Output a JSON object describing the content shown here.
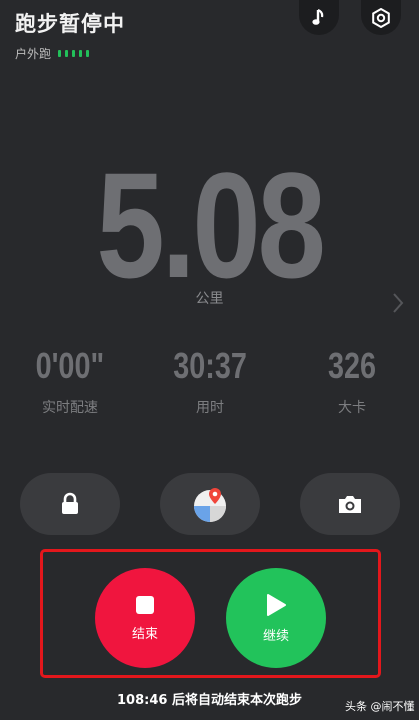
{
  "header": {
    "title": "跑步暂停中",
    "mode_label": "户外跑",
    "signal_bars": 5
  },
  "colors": {
    "background": "#28292c",
    "end_button": "#f0153e",
    "resume_button": "#22c35b",
    "signal": "#22c05a",
    "highlight_border": "#e3171c"
  },
  "icons": {
    "music": "music-note-icon",
    "settings": "gear-icon",
    "lock": "lock-icon",
    "map": "map-pin-icon",
    "camera": "camera-icon",
    "end": "stop-icon",
    "resume": "play-icon",
    "next": "chevron-right-icon"
  },
  "main": {
    "distance_value": "5.08",
    "distance_unit": "公里"
  },
  "stats": [
    {
      "value": "0'00\"",
      "label": "实时配速"
    },
    {
      "value": "30:37",
      "label": "用时"
    },
    {
      "value": "326",
      "label": "大卡"
    }
  ],
  "controls": {
    "end_label": "结束",
    "resume_label": "继续"
  },
  "footer": {
    "notice": "108:46 后将自动结束本次跑步",
    "watermark": "头条 @闹不懂"
  }
}
